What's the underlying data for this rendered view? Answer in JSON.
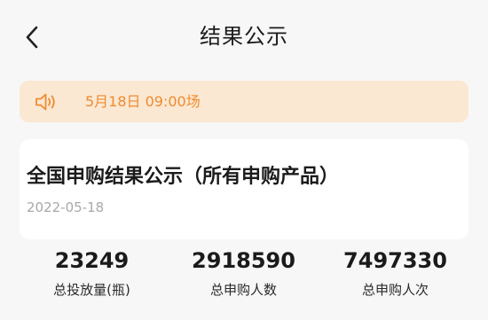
{
  "header": {
    "title": "结果公示"
  },
  "notice": {
    "text": "5月18日 09:00场"
  },
  "card": {
    "heading": "全国申购结果公示（所有申购产品）",
    "date": "2022-05-18"
  },
  "stats": [
    {
      "value": "23249",
      "label": "总投放量(瓶)"
    },
    {
      "value": "2918590",
      "label": "总申购人数"
    },
    {
      "value": "7497330",
      "label": "总申购人次"
    }
  ],
  "colors": {
    "background": "#f7f7f7",
    "notice_bg": "#fbe8d3",
    "accent": "#ef8b2f",
    "muted": "#a8a8a8"
  }
}
